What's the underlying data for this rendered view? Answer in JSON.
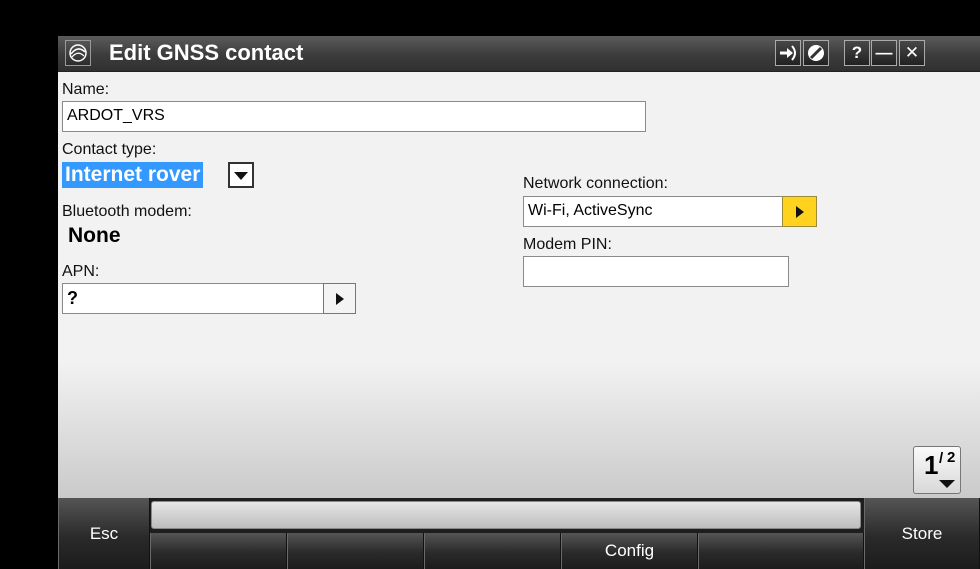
{
  "window": {
    "title": "Edit GNSS contact",
    "logo_icon": "trimble-logo-icon",
    "title_buttons": [
      {
        "name": "connect-icon",
        "glyph": "➔"
      },
      {
        "name": "cancel-circle-icon",
        "glyph": "⊘"
      },
      {
        "name": "help-button",
        "label": "?"
      },
      {
        "name": "minimize-button",
        "label": "—"
      },
      {
        "name": "close-button",
        "label": "✕"
      }
    ]
  },
  "form": {
    "name_label": "Name:",
    "name_value": "ARDOT_VRS",
    "contact_type_label": "Contact type:",
    "contact_type_value": "Internet rover",
    "bluetooth_label": "Bluetooth modem:",
    "bluetooth_value": "None",
    "apn_label": "APN:",
    "apn_value": "?",
    "network_label": "Network connection:",
    "network_value": "Wi-Fi, ActiveSync",
    "modem_pin_label": "Modem PIN:",
    "modem_pin_value": ""
  },
  "pager": {
    "current": "1",
    "sep": "/",
    "total": "2"
  },
  "softkeys": {
    "esc": "Esc",
    "config": "Config",
    "store": "Store"
  },
  "colors": {
    "selection": "#3399ff",
    "highlight_button": "#ffd21e"
  }
}
